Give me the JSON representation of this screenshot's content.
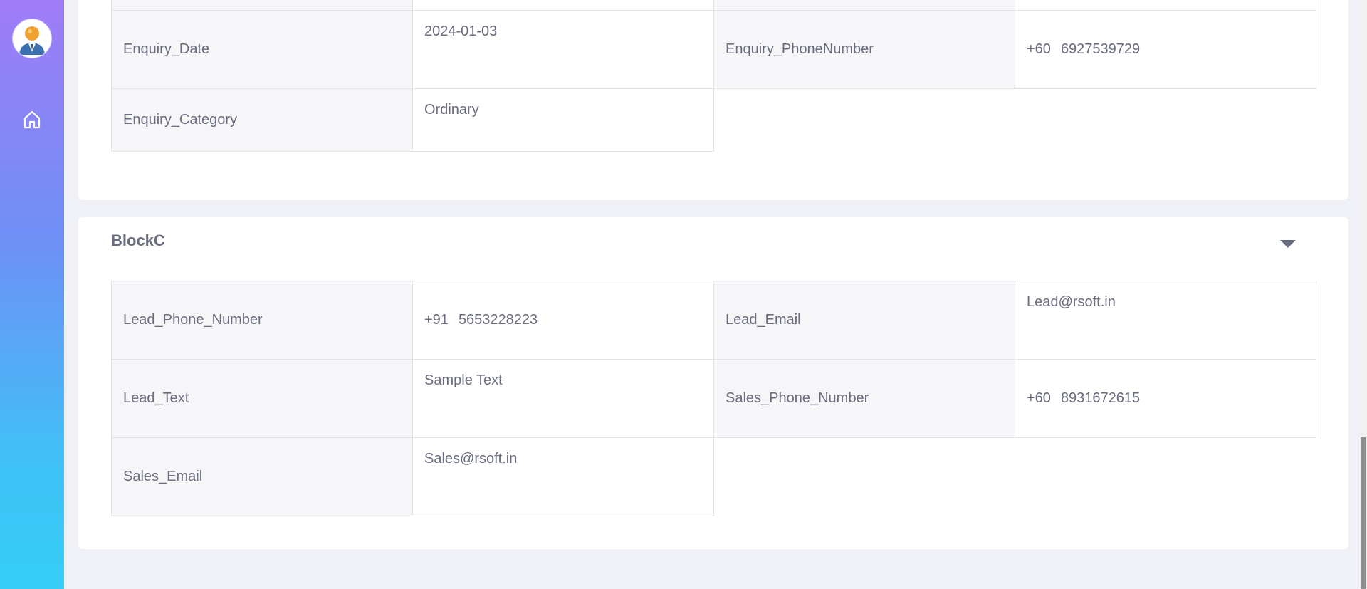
{
  "sidebar": {
    "avatar": "avatar",
    "home_icon": "home-icon"
  },
  "block_a": {
    "rows": [
      {
        "l1": "Enquiry_Date",
        "v1": "2024-01-03",
        "l2": "Enquiry_PhoneNumber",
        "v2_cc": "+60",
        "v2_num": "6927539729"
      },
      {
        "l1": "Enquiry_Category",
        "v1": "Ordinary"
      }
    ]
  },
  "block_c": {
    "title": "BlockC",
    "toggle_icon": "caret-down-icon",
    "rows": [
      {
        "l1": "Lead_Phone_Number",
        "v1_cc": "+91",
        "v1_num": "5653228223",
        "l2": "Lead_Email",
        "v2": "Lead@rsoft.in"
      },
      {
        "l1": "Lead_Text",
        "v1": "Sample Text",
        "l2": "Sales_Phone_Number",
        "v2_cc": "+60",
        "v2_num": "8931672615"
      },
      {
        "l1": "Sales_Email",
        "v1": "Sales@rsoft.in"
      }
    ]
  },
  "colors": {
    "sidebar_top": "#a07cf7",
    "sidebar_bottom": "#35cdf8",
    "label_bg": "#f6f6f8",
    "page_bg": "#f0f1f6"
  }
}
